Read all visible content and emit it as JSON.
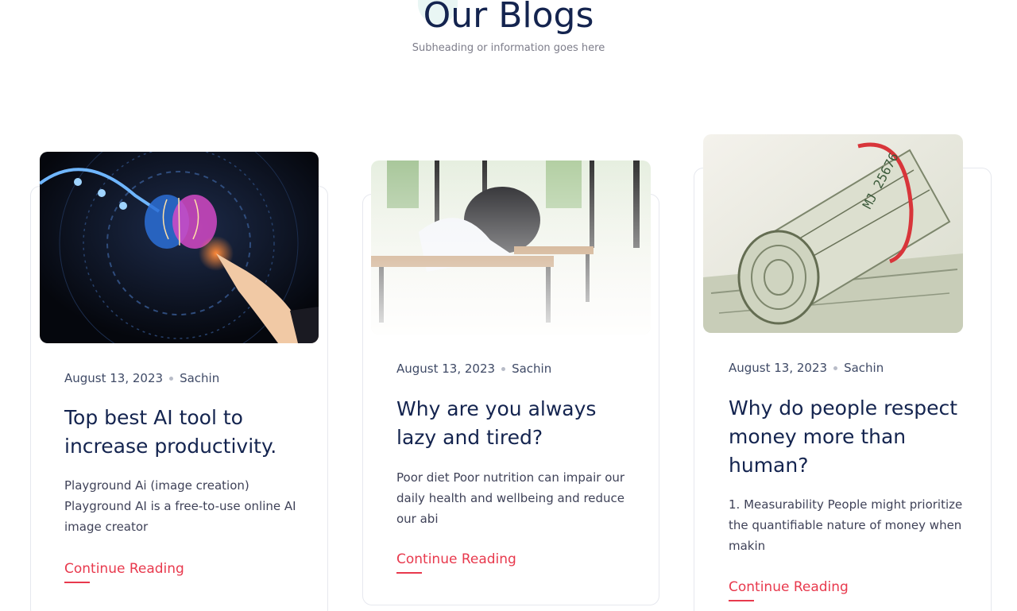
{
  "section": {
    "title": "Our Blogs",
    "subtitle": "Subheading or information goes here"
  },
  "cards": [
    {
      "date": "August 13, 2023",
      "author": "Sachin",
      "title": "Top best AI tool to increase productivity.",
      "excerpt": "Playground Ai (image creation) Playground AI is a free-to-use online AI image creator",
      "link": "Continue Reading",
      "image": "ai-brain-illustration"
    },
    {
      "date": "August 13, 2023",
      "author": "Sachin",
      "title": "Why are you always lazy and tired?",
      "excerpt": "Poor diet Poor nutrition can impair our daily health and wellbeing and reduce our abi",
      "link": "Continue Reading",
      "image": "student-sleeping-on-desk"
    },
    {
      "date": "August 13, 2023",
      "author": "Sachin",
      "title": "Why do people respect money more than human?",
      "excerpt": "1. Measurability  People might prioritize the quantifiable nature of money when makin",
      "link": "Continue Reading",
      "image": "rolled-dollar-bills"
    }
  ],
  "colors": {
    "title": "#14244f",
    "accent": "#e8394d",
    "text": "#3f4258"
  }
}
